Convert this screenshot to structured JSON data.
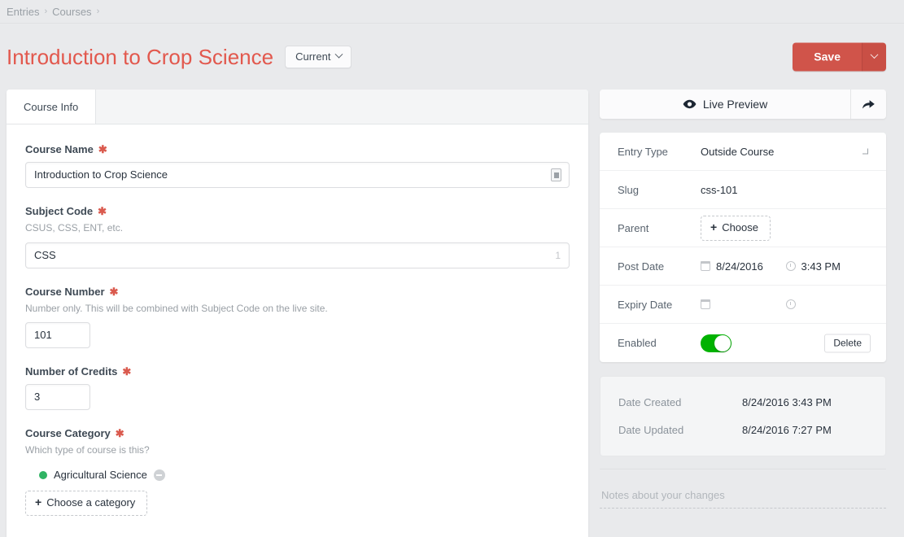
{
  "breadcrumb": {
    "items": [
      {
        "label": "Entries"
      },
      {
        "label": "Courses"
      }
    ],
    "separator": "›"
  },
  "header": {
    "title": "Introduction to Crop Science",
    "revision_label": "Current",
    "save_label": "Save"
  },
  "tabs": [
    {
      "label": "Course Info",
      "active": true
    }
  ],
  "fields": {
    "course_name": {
      "label": "Course Name",
      "required_mark": "✱",
      "value": "Introduction to Crop Science"
    },
    "subject_code": {
      "label": "Subject Code",
      "required_mark": "✱",
      "instructions": "CSUS, CSS, ENT, etc.",
      "value": "CSS",
      "counter": "1"
    },
    "course_number": {
      "label": "Course Number",
      "required_mark": "✱",
      "instructions": "Number only. This will be combined with Subject Code on the live site.",
      "value": "101"
    },
    "number_of_credits": {
      "label": "Number of Credits",
      "required_mark": "✱",
      "value": "3"
    },
    "course_category": {
      "label": "Course Category",
      "required_mark": "✱",
      "instructions": "Which type of course is this?",
      "selected": [
        {
          "label": "Agricultural Science",
          "dot_color": "#2fb363"
        }
      ],
      "choose_label": "Choose a category",
      "plus": "+"
    }
  },
  "sidebar": {
    "live_preview_label": "Live Preview",
    "meta": {
      "entry_type": {
        "label": "Entry Type",
        "value": "Outside Course"
      },
      "slug": {
        "label": "Slug",
        "value": "css-101"
      },
      "parent": {
        "label": "Parent",
        "choose_label": "Choose",
        "plus": "+"
      },
      "post_date": {
        "label": "Post Date",
        "date": "8/24/2016",
        "time": "3:43 PM"
      },
      "expiry_date": {
        "label": "Expiry Date",
        "date": "",
        "time": ""
      },
      "enabled": {
        "label": "Enabled",
        "delete_label": "Delete",
        "toggle_on": true
      }
    },
    "dates": {
      "created_label": "Date Created",
      "created_value": "8/24/2016 3:43 PM",
      "updated_label": "Date Updated",
      "updated_value": "8/24/2016 7:27 PM"
    },
    "notes_placeholder": "Notes about your changes"
  },
  "colors": {
    "accent_red": "#d0544a",
    "title_red": "#e2584d",
    "toggle_green": "#00b200",
    "category_green": "#2fb363",
    "page_bg": "#e9eaec"
  }
}
